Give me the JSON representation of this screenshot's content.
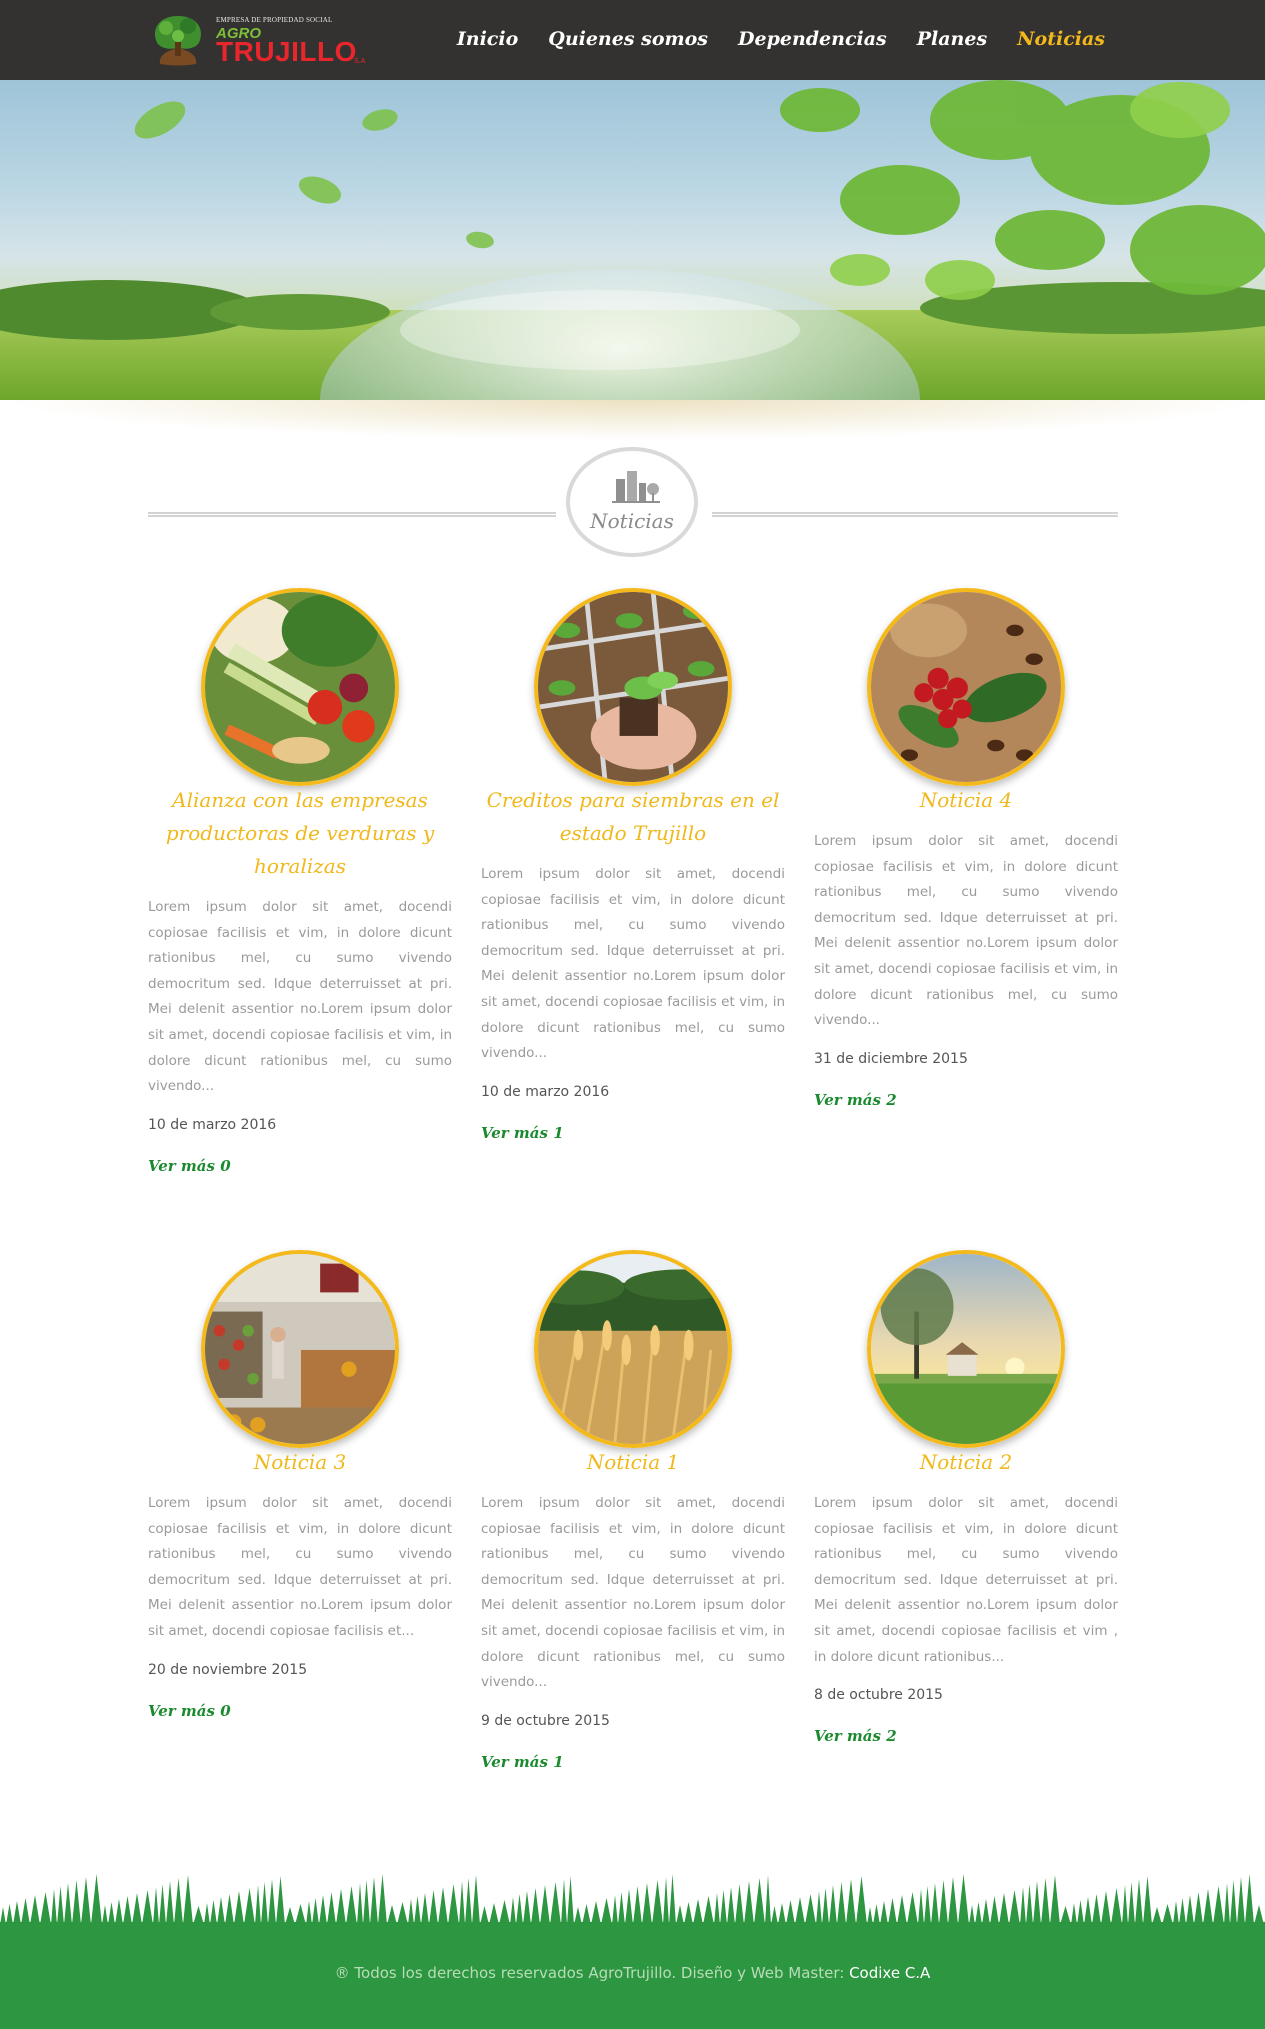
{
  "header": {
    "logo": {
      "tagline": "EMPRESA DE PROPIEDAD SOCIAL",
      "agro": "AGRO",
      "name": "TRUJILLO",
      "suffix": "S.A"
    },
    "nav": [
      {
        "label": "Inicio",
        "active": false
      },
      {
        "label": "Quienes somos",
        "active": false
      },
      {
        "label": "Dependencias",
        "active": false
      },
      {
        "label": "Planes",
        "active": false
      },
      {
        "label": "Noticias",
        "active": true
      }
    ]
  },
  "section": {
    "title": "Noticias",
    "icon": "city-buildings-icon"
  },
  "news": [
    {
      "title": "Alianza con las empresas productoras de verduras y horalizas",
      "text": "Lorem ipsum dolor sit amet, docendi copiosae facilisis et vim, in dolore dicunt rationibus mel, cu sumo vivendo democritum sed. Idque deterruisset at pri. Mei delenit assentior no.Lorem ipsum dolor sit amet, docendi copiosae facilisis et vim, in dolore dicunt rationibus mel, cu sumo vivendo...",
      "date": "10 de marzo 2016",
      "more": "Ver más 0",
      "image": "vegetables-photo"
    },
    {
      "title": "Creditos para siembras en el estado Trujillo",
      "text": "Lorem ipsum dolor sit amet, docendi copiosae facilisis et vim, in dolore dicunt rationibus mel, cu sumo vivendo democritum sed. Idque deterruisset at pri. Mei delenit assentior no.Lorem ipsum dolor sit amet, docendi copiosae facilisis et vim, in dolore dicunt rationibus mel, cu sumo vivendo...",
      "date": "10 de marzo 2016",
      "more": "Ver más 1",
      "image": "seedlings-photo"
    },
    {
      "title": "Noticia 4",
      "text": "Lorem ipsum dolor sit amet, docendi copiosae facilisis et vim, in dolore dicunt rationibus mel, cu sumo vivendo democritum sed. Idque deterruisset at pri. Mei delenit assentior no.Lorem ipsum dolor sit amet, docendi copiosae facilisis et vim, in dolore dicunt rationibus mel, cu sumo vivendo...",
      "date": "31 de diciembre 2015",
      "more": "Ver más 2",
      "image": "coffee-cherries-photo"
    },
    {
      "title": "Noticia 3",
      "text": "Lorem ipsum dolor sit amet, docendi copiosae facilisis et vim, in dolore dicunt rationibus mel, cu sumo vivendo democritum sed. Idque deterruisset at pri. Mei delenit assentior no.Lorem ipsum dolor sit amet, docendi copiosae facilisis et...",
      "date": "20 de noviembre 2015",
      "more": "Ver más 0",
      "image": "market-photo"
    },
    {
      "title": "Noticia 1",
      "text": "Lorem ipsum dolor sit amet, docendi copiosae facilisis et vim, in dolore dicunt rationibus mel, cu sumo vivendo democritum sed. Idque deterruisset at pri. Mei delenit assentior no.Lorem ipsum dolor sit amet, docendi copiosae facilisis et vim, in dolore dicunt rationibus mel, cu sumo vivendo...",
      "date": "9 de octubre 2015",
      "more": "Ver más 1",
      "image": "wheat-field-photo"
    },
    {
      "title": "Noticia 2",
      "text": "Lorem ipsum dolor sit amet, docendi copiosae facilisis et vim, in dolore dicunt rationibus mel, cu sumo vivendo democritum sed. Idque deterruisset at pri. Mei delenit assentior no.Lorem ipsum dolor sit amet, docendi copiosae facilisis et vim , in dolore dicunt rationibus...",
      "date": "8 de octubre 2015",
      "more": "Ver más 2",
      "image": "countryside-sunset-photo"
    }
  ],
  "footer": {
    "text": "® Todos los derechos reservados AgroTrujillo. Diseño y Web Master:",
    "brand": "Codixe C.A"
  },
  "colors": {
    "header_bg": "#333231",
    "accent": "#f3b91c",
    "link_green": "#1b8a2e",
    "footer_green": "#2c9640"
  }
}
